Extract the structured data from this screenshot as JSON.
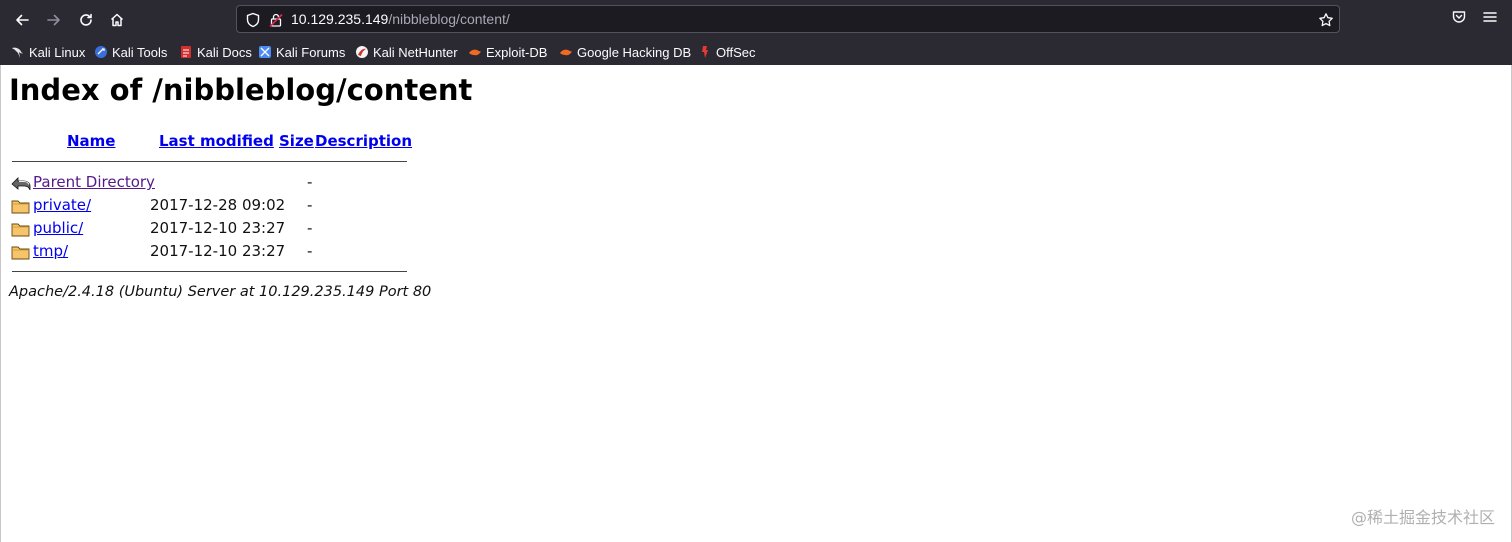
{
  "browser": {
    "url_host": "10.129.235.149",
    "url_path": "/nibbleblog/content/",
    "nav": {
      "back_icon": "arrow-left-icon",
      "forward_icon": "arrow-right-icon",
      "reload_icon": "reload-icon",
      "home_icon": "home-icon"
    },
    "bookmarks": [
      {
        "label": "Kali Linux",
        "icon": "kali-dragon-icon"
      },
      {
        "label": "Kali Tools",
        "icon": "kali-tools-icon"
      },
      {
        "label": "Kali Docs",
        "icon": "kali-docs-icon"
      },
      {
        "label": "Kali Forums",
        "icon": "kali-forums-icon"
      },
      {
        "label": "Kali NetHunter",
        "icon": "nethunter-icon"
      },
      {
        "label": "Exploit-DB",
        "icon": "exploit-db-icon"
      },
      {
        "label": "Google Hacking DB",
        "icon": "ghdb-icon"
      },
      {
        "label": "OffSec",
        "icon": "offsec-icon"
      }
    ],
    "colors": {
      "chrome_bg": "#2b2a33",
      "urlbar_bg": "#1c1b22",
      "link": "#0000ee",
      "visited_link": "#551a8b"
    }
  },
  "page": {
    "title": "Index of /nibbleblog/content",
    "columns": {
      "name": "Name",
      "last_modified": "Last modified",
      "size": "Size",
      "description": "Description"
    },
    "rows": [
      {
        "name": "Parent Directory",
        "date": "",
        "size": "-",
        "icon": "back-arrow-icon"
      },
      {
        "name": "private/",
        "date": "2017-12-28 09:02",
        "size": "-",
        "icon": "folder-icon"
      },
      {
        "name": "public/",
        "date": "2017-12-10 23:27",
        "size": "-",
        "icon": "folder-icon"
      },
      {
        "name": "tmp/",
        "date": "2017-12-10 23:27",
        "size": "-",
        "icon": "folder-icon"
      }
    ],
    "address": "Apache/2.4.18 (Ubuntu) Server at 10.129.235.149 Port 80"
  },
  "watermark": "@稀土掘金技术社区"
}
